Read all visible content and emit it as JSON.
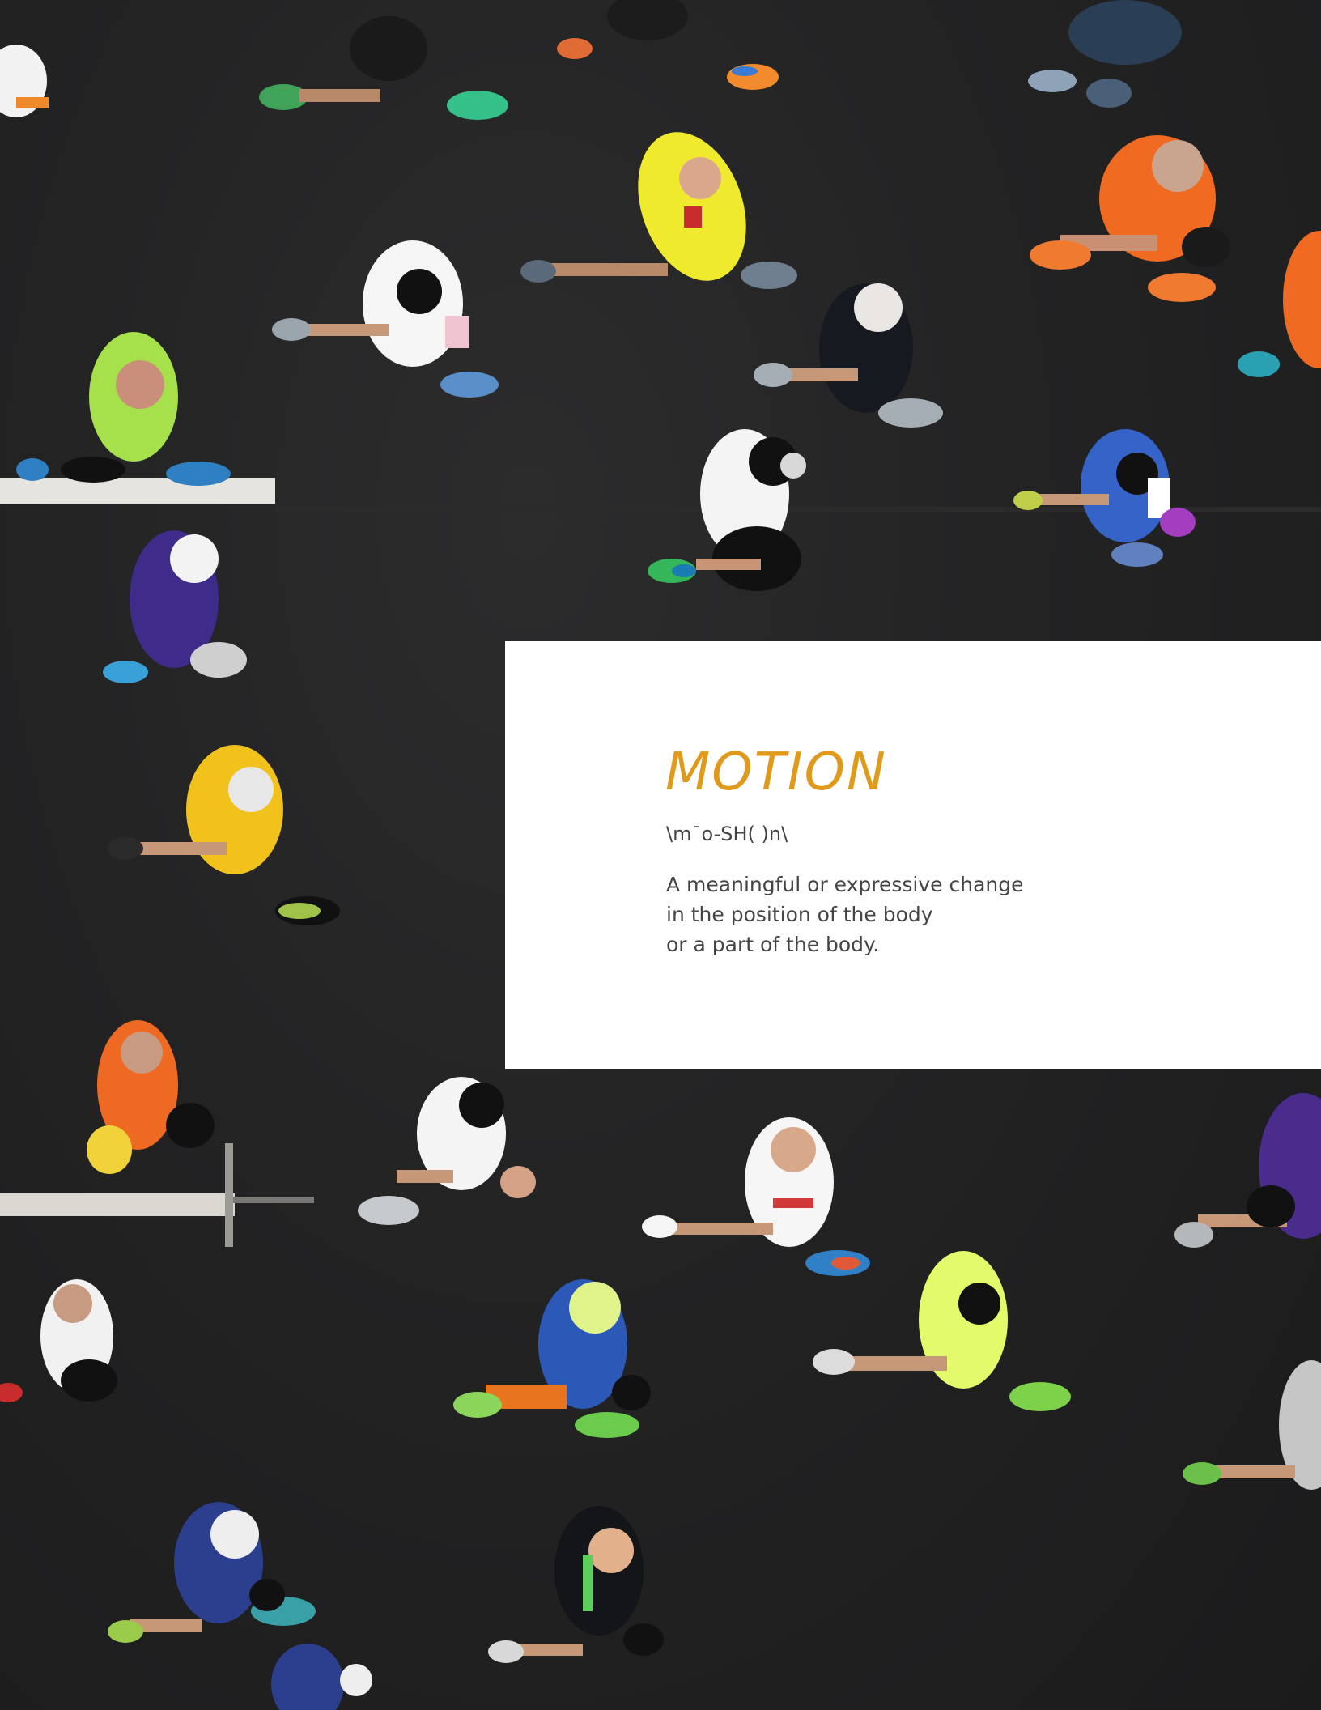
{
  "definition": {
    "term": "MOTION",
    "pronunciation": "\\m¯o-SH( )n\\",
    "lines": [
      "A meaningful or expressive change",
      "in the position of the body",
      "or a part of the body."
    ]
  },
  "colors": {
    "accent": "#df9a1b",
    "text": "#444444",
    "asphalt": "#232324",
    "card": "#ffffff"
  }
}
